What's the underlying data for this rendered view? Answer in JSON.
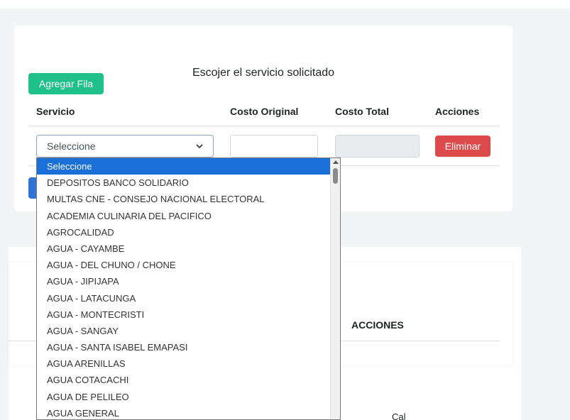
{
  "form": {
    "title": "Escojer el servicio solicitado",
    "add_row_label": "Agregar Fila",
    "columns": [
      "Servicio",
      "Costo Original",
      "Costo Total",
      "Acciones"
    ],
    "row": {
      "service_selected": "Seleccione",
      "costo_original": "",
      "costo_total": "",
      "delete_label": "Eliminar"
    }
  },
  "lower_table": {
    "acciones_header": "ACCIONES",
    "partial_text": "Cal"
  },
  "dropdown": {
    "selected_index": 0,
    "options": [
      "Seleccione",
      "DEPOSITOS BANCO SOLIDARIO",
      "MULTAS CNE - CONSEJO NACIONAL ELECTORAL",
      "ACADEMIA CULINARIA DEL PACIFICO",
      "AGROCALIDAD",
      "AGUA - CAYAMBE",
      "AGUA - DEL CHUNO / CHONE",
      "AGUA - JIPIJAPA",
      "AGUA - LATACUNGA",
      "AGUA - MONTECRISTI",
      "AGUA - SANGAY",
      "AGUA - SANTA ISABEL EMAPASI",
      "AGUA ARENILLAS",
      "AGUA COTACACHI",
      "AGUA DE PELILEO",
      "AGUA GENERAL"
    ]
  },
  "colors": {
    "add_button": "#20c08a",
    "delete_button": "#dc4a4a",
    "selected_option": "#1a6fd8"
  }
}
